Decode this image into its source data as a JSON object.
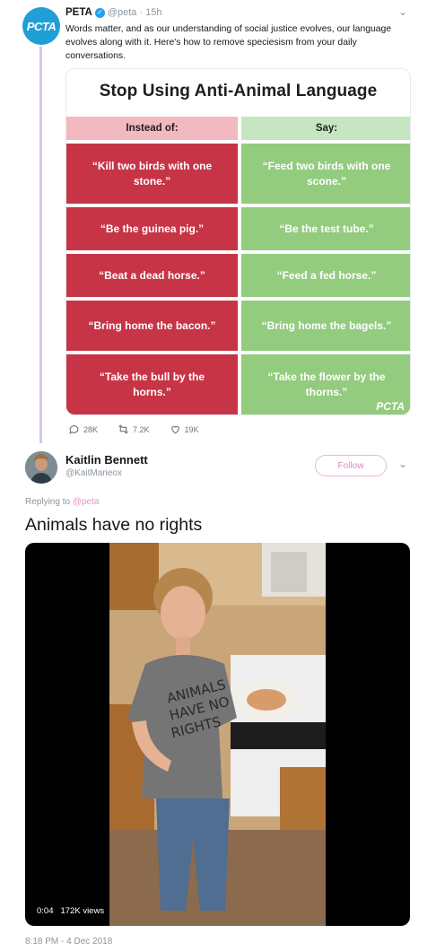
{
  "tweet1": {
    "avatar_text": "PCTA",
    "name": "PETA",
    "handle": "@peta",
    "sep": "·",
    "time": "15h",
    "text": "Words matter, and as our understanding of social justice evolves, our language evolves along with it. Here's how to remove speciesism from your daily conversations."
  },
  "infographic": {
    "title": "Stop Using Anti-Animal Language",
    "header_left": "Instead of:",
    "header_right": "Say:",
    "rows": [
      {
        "instead": "“Kill two birds with one stone.”",
        "say": "“Feed two birds with one scone.”"
      },
      {
        "instead": "“Be the guinea pig.”",
        "say": "“Be the test tube.”"
      },
      {
        "instead": "“Beat a dead horse.”",
        "say": "“Feed a fed horse.”"
      },
      {
        "instead": "“Bring home the bacon.”",
        "say": "“Bring home the bagels.”"
      },
      {
        "instead": "“Take the bull by the horns.”",
        "say": "“Take the flower by the thorns.”"
      }
    ],
    "logo_text": "PCTA",
    "colors": {
      "instead_header": "#f2b9c0",
      "say_header": "#c6e6c1",
      "instead_cell": "#c73446",
      "say_cell": "#93cb7f"
    }
  },
  "actions": {
    "replies": "28K",
    "retweets": "7.2K",
    "likes": "19K"
  },
  "tweet2": {
    "name": "Kaitlin Bennett",
    "handle": "@KaitMarieox",
    "follow_label": "Follow",
    "reply_prefix": "Replying to",
    "reply_handle": "@peta",
    "text": "Animals have no rights",
    "video_time": "0:04",
    "video_views": "172K views",
    "timestamp": "8:18 PM - 4 Dec 2018"
  },
  "colors": {
    "accent": "#e295c6",
    "thread_line": "#d7c4e6",
    "verified": "#1da1f2"
  }
}
